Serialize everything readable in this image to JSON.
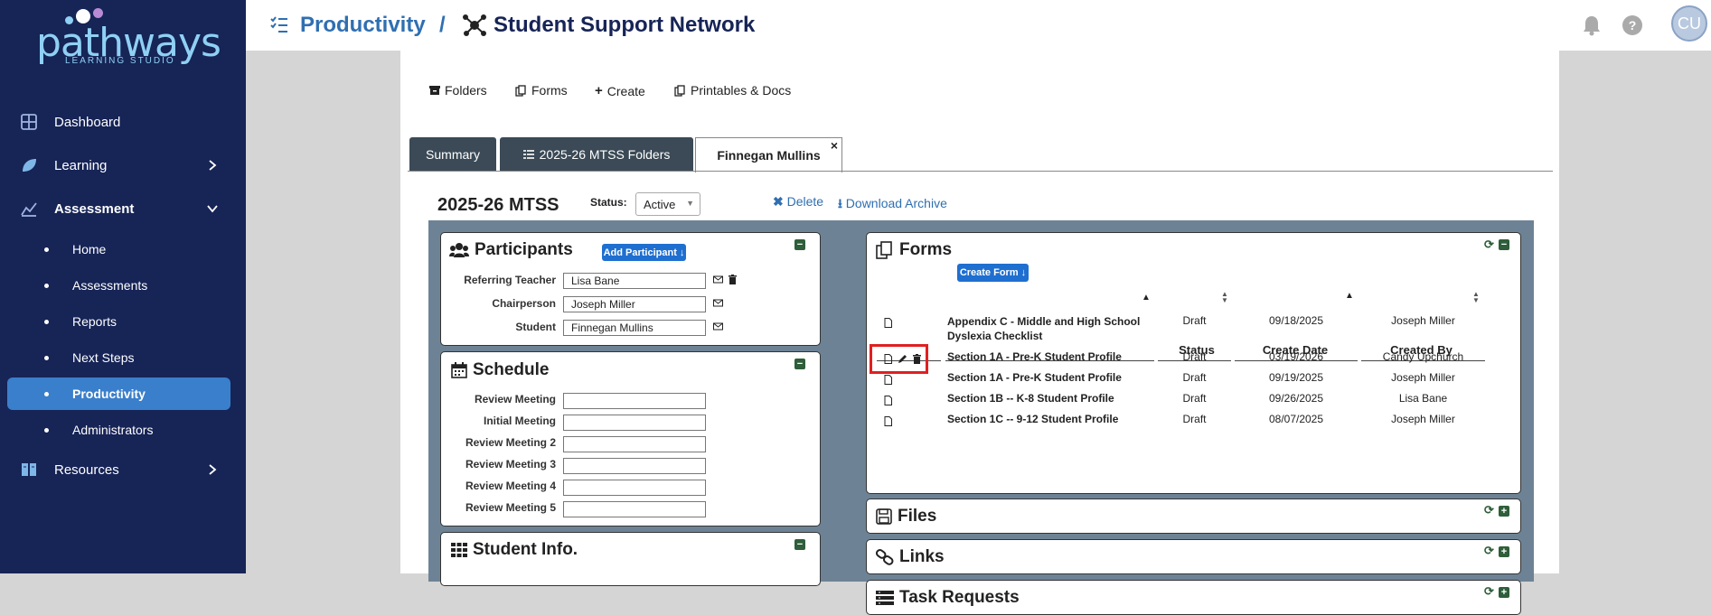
{
  "sidebar": {
    "logo_word": "pathways",
    "logo_sub": "LEARNING STUDIO",
    "nav": [
      {
        "label": "Dashboard"
      },
      {
        "label": "Learning"
      },
      {
        "label": "Assessment"
      },
      {
        "label": "Resources"
      }
    ],
    "sub_items": [
      "Home",
      "Assessments",
      "Reports",
      "Next Steps",
      "Productivity",
      "Administrators"
    ]
  },
  "topbar": {
    "section": "Productivity",
    "separator": "/",
    "page": "Student Support Network",
    "avatar": "CU"
  },
  "toolbar": [
    "Folders",
    "Forms",
    "Create",
    "Printables & Docs"
  ],
  "tabs": [
    "Summary",
    "2025-26 MTSS Folders",
    "Finnegan Mullins"
  ],
  "tab_close": "×",
  "header": {
    "title": "2025-26 MTSS",
    "status_label": "Status:",
    "status_value": "Active",
    "delete": "Delete",
    "download": "Download Archive"
  },
  "participants": {
    "title": "Participants",
    "add": "Add Participant ↓",
    "rows": [
      {
        "label": "Referring Teacher",
        "value": "Lisa Bane"
      },
      {
        "label": "Chairperson",
        "value": "Joseph Miller"
      },
      {
        "label": "Student",
        "value": "Finnegan Mullins"
      }
    ]
  },
  "schedule": {
    "title": "Schedule",
    "rows": [
      "Review Meeting",
      "Initial Meeting",
      "Review Meeting 2",
      "Review Meeting 3",
      "Review Meeting 4",
      "Review Meeting 5"
    ]
  },
  "student_info": {
    "title": "Student Info."
  },
  "forms": {
    "title": "Forms",
    "create": "Create Form ↓",
    "columns": [
      "Status",
      "Create Date",
      "Created By"
    ],
    "rows": [
      {
        "name": "Appendix C - Middle and High School Dyslexia Checklist",
        "status": "Draft",
        "date": "09/18/2025",
        "by": "Joseph Miller"
      },
      {
        "name": "Section 1A - Pre-K Student Profile",
        "status": "Draft",
        "date": "03/19/2026",
        "by": "Candy Upchurch"
      },
      {
        "name": "Section 1A - Pre-K Student Profile",
        "status": "Draft",
        "date": "09/19/2025",
        "by": "Joseph Miller"
      },
      {
        "name": "Section 1B -- K-8 Student Profile",
        "status": "Draft",
        "date": "09/26/2025",
        "by": "Lisa Bane"
      },
      {
        "name": "Section 1C -- 9-12 Student Profile",
        "status": "Draft",
        "date": "08/07/2025",
        "by": "Joseph Miller"
      }
    ]
  },
  "files": {
    "title": "Files"
  },
  "links": {
    "title": "Links"
  },
  "tasks": {
    "title": "Task Requests"
  },
  "colors": {
    "sidebar": "#162456",
    "active": "#3a7fcb",
    "brand_blue": "#2f6fb1",
    "highlight": "#e02020"
  }
}
